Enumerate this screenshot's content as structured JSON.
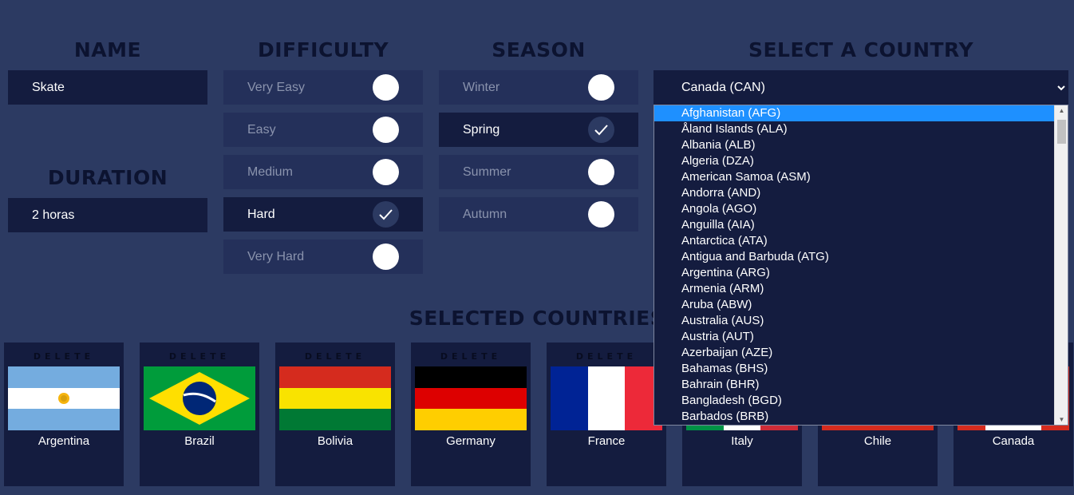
{
  "headings": {
    "name": "NAME",
    "difficulty": "DIFFICULTY",
    "season": "SEASON",
    "country": "SELECT A COUNTRY",
    "duration": "DURATION",
    "selected": "SELECTED COUNTRIES"
  },
  "name_value": "Skate",
  "duration_value": "2 horas",
  "difficulty": [
    {
      "label": "Very Easy",
      "selected": false
    },
    {
      "label": "Easy",
      "selected": false
    },
    {
      "label": "Medium",
      "selected": false
    },
    {
      "label": "Hard",
      "selected": true
    },
    {
      "label": "Very Hard",
      "selected": false
    }
  ],
  "season": [
    {
      "label": "Winter",
      "selected": false
    },
    {
      "label": "Spring",
      "selected": true
    },
    {
      "label": "Summer",
      "selected": false
    },
    {
      "label": "Autumn",
      "selected": false
    }
  ],
  "country_select": {
    "value": "Canada (CAN)",
    "options": [
      "Afghanistan (AFG)",
      "Åland Islands (ALA)",
      "Albania (ALB)",
      "Algeria (DZA)",
      "American Samoa (ASM)",
      "Andorra (AND)",
      "Angola (AGO)",
      "Anguilla (AIA)",
      "Antarctica (ATA)",
      "Antigua and Barbuda (ATG)",
      "Argentina (ARG)",
      "Armenia (ARM)",
      "Aruba (ABW)",
      "Australia (AUS)",
      "Austria (AUT)",
      "Azerbaijan (AZE)",
      "Bahamas (BHS)",
      "Bahrain (BHR)",
      "Bangladesh (BGD)",
      "Barbados (BRB)"
    ],
    "highlighted": "Afghanistan (AFG)"
  },
  "delete_label": "DELETE",
  "selected_countries": [
    "Argentina",
    "Brazil",
    "Bolivia",
    "Germany",
    "France",
    "Italy",
    "Chile",
    "Canada"
  ],
  "colors": {
    "background": "#2c3a62",
    "field": "#141c3f",
    "option": "#24305a",
    "heading": "#0c1330",
    "highlight": "#1e90ff"
  }
}
